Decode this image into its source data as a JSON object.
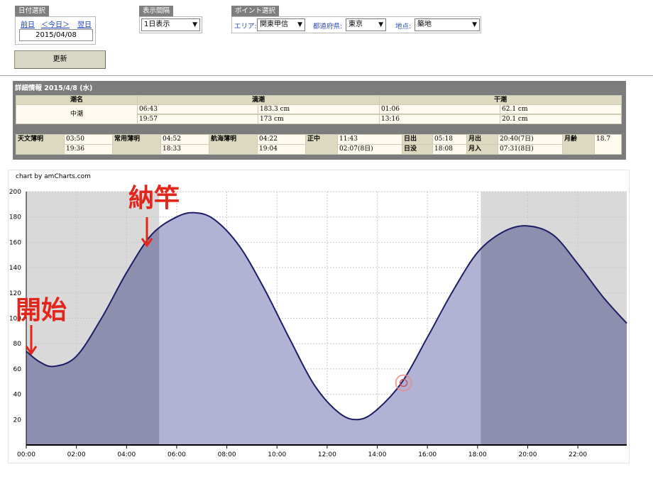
{
  "controls": {
    "date_select_label": "日付選択",
    "prev_label": "前日",
    "today_label": "＜今日＞",
    "next_label": "翌日",
    "date_value": "2015/04/08",
    "update_label": "更新",
    "interval_label": "表示間隔",
    "interval_value": "1日表示",
    "point_label": "ポイント選択",
    "area_label": "エリア:",
    "area_value": "関東甲信",
    "pref_label": "都道府県:",
    "pref_value": "東京",
    "spot_label": "地点:",
    "spot_value": "築地"
  },
  "detail": {
    "title": "詳細情報 2015/4/8 (水)",
    "headers": {
      "tide_name": "潮名",
      "high": "満潮",
      "low": "干潮"
    },
    "tide_name": "中潮",
    "high_rows": [
      [
        "06:43",
        "183.3 cm"
      ],
      [
        "19:57",
        "173 cm"
      ]
    ],
    "low_rows": [
      [
        "01:06",
        "62.1 cm"
      ],
      [
        "13:16",
        "20.1 cm"
      ]
    ],
    "astro": [
      {
        "label": "天文薄明",
        "values": [
          "03:50",
          "19:36"
        ]
      },
      {
        "label": "常用薄明",
        "values": [
          "04:52",
          "18:33"
        ]
      },
      {
        "label": "航海薄明",
        "values": [
          "04:22",
          "19:04"
        ]
      },
      {
        "label": "正中",
        "values": [
          "11:43",
          "02:07(8日)"
        ]
      }
    ],
    "sun": {
      "rise_label": "日出",
      "rise": "05:18",
      "set_label": "日没",
      "set": "18:08"
    },
    "moon": {
      "rise_label": "月出",
      "rise": "20:40(7日)",
      "set_label": "月入",
      "set": "07:31(8日)"
    },
    "age_label": "月齢",
    "age_value": "18.7"
  },
  "chart_credit": "chart by amCharts.com",
  "annotations": {
    "start": "開始",
    "fishing_end": "納竿"
  },
  "colors": {
    "fill": "#b1b2d4",
    "night_fill": "#8e8fae",
    "line": "#1d1d66",
    "annotation": "#e3261c",
    "night_bg": "#d9d9d9"
  },
  "chart_data": {
    "type": "area",
    "x_unit": "hour",
    "x_ticks": [
      "00:00",
      "02:00",
      "04:00",
      "06:00",
      "08:00",
      "10:00",
      "12:00",
      "14:00",
      "16:00",
      "18:00",
      "20:00",
      "22:00"
    ],
    "ylim": [
      0,
      200
    ],
    "y_ticks": [
      20,
      40,
      60,
      80,
      100,
      120,
      140,
      160,
      180,
      200
    ],
    "x": [
      0,
      0.5,
      1.1,
      2,
      3,
      4,
      5,
      6,
      6.72,
      7.5,
      8.5,
      9.5,
      10.5,
      11.5,
      12.5,
      13.27,
      14,
      15,
      16,
      17,
      18,
      19,
      19.95,
      21,
      22,
      23,
      23.95
    ],
    "y": [
      74,
      66,
      62,
      70,
      100,
      136,
      166,
      180,
      183.3,
      178,
      157,
      123,
      84,
      47,
      25,
      20.1,
      28,
      50,
      85,
      121,
      152,
      168,
      173,
      166,
      143,
      117,
      96
    ],
    "night_ranges": [
      [
        0,
        5.3
      ],
      [
        18.13,
        24
      ]
    ],
    "marker": {
      "x": 15.05,
      "y": 49
    },
    "grid": true
  }
}
